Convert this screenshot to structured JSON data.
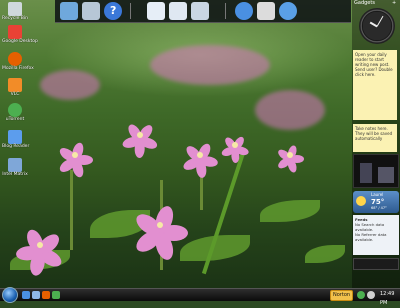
{
  "desktop": {
    "icons": [
      {
        "label": "Recycle Bin",
        "color": "#cfd8dc"
      },
      {
        "label": "Google Desktop",
        "color": "#e94235"
      },
      {
        "label": "Mozilla Firefox",
        "color": "#e66000"
      },
      {
        "label": "VLC",
        "color": "#f28c28"
      },
      {
        "label": "uTorrent",
        "color": "#4caf50"
      },
      {
        "label": "Blog Reader",
        "color": "#5c9ded"
      },
      {
        "label": "Intel Matrix",
        "color": "#7fa7d8"
      }
    ]
  },
  "quick_launch": {
    "icons": [
      {
        "name": "show-desktop-icon",
        "color": "#6fa8dc"
      },
      {
        "name": "computer-icon",
        "color": "#b7c7d6"
      },
      {
        "name": "help-icon",
        "color": "#3b78d8"
      },
      {
        "name": "document-icon",
        "color": "#e6eef7"
      },
      {
        "name": "notepad-icon",
        "color": "#dfe8f2"
      },
      {
        "name": "folder-icon",
        "color": "#c9d6e3"
      },
      {
        "name": "media-player-icon",
        "color": "#4a90e2"
      },
      {
        "name": "mail-icon",
        "color": "#dcdcdc"
      },
      {
        "name": "internet-explorer-icon",
        "color": "#5aa0e6"
      }
    ]
  },
  "sidebar": {
    "header": "Gadgets",
    "note_top": "Open your daily reader to start writing new post. Send user? Double click here.",
    "note_bottom": "Take notes here. They will be saved automatically",
    "weather": {
      "location": "Laurel",
      "temp": "75°",
      "range": "68° / 47°"
    },
    "feed_header": "Feeds",
    "feed_lines": [
      "No Search data available.",
      "No Referrer data available."
    ]
  },
  "taskbar": {
    "tray_label": "Norton",
    "time": "12:49 PM"
  }
}
